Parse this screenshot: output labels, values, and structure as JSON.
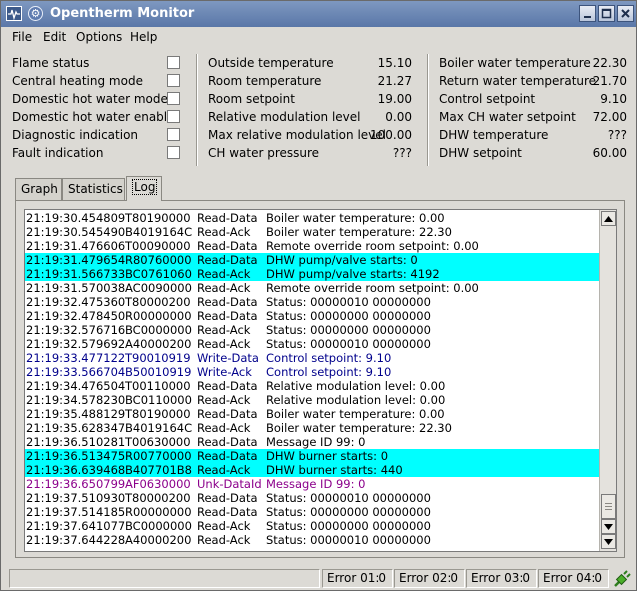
{
  "window": {
    "title": "Opentherm Monitor"
  },
  "menu": [
    "File",
    "Edit",
    "Options",
    "Help"
  ],
  "flags": [
    {
      "label": "Flame status",
      "checked": false
    },
    {
      "label": "Central heating mode",
      "checked": false
    },
    {
      "label": "Domestic hot water mode",
      "checked": false
    },
    {
      "label": "Domestic hot water enable",
      "checked": false
    },
    {
      "label": "Diagnostic indication",
      "checked": false
    },
    {
      "label": "Fault indication",
      "checked": false
    }
  ],
  "middle": [
    {
      "label": "Outside temperature",
      "value": "15.10"
    },
    {
      "label": "Room temperature",
      "value": "21.27"
    },
    {
      "label": "Room setpoint",
      "value": "19.00"
    },
    {
      "label": "Relative modulation level",
      "value": "0.00"
    },
    {
      "label": "Max relative modulation level",
      "value": "100.00"
    },
    {
      "label": "CH water pressure",
      "value": "???"
    }
  ],
  "right": [
    {
      "label": "Boiler water temperature",
      "value": "22.30"
    },
    {
      "label": "Return water temperature",
      "value": "21.70"
    },
    {
      "label": "Control setpoint",
      "value": "9.10"
    },
    {
      "label": "Max CH water setpoint",
      "value": "72.00"
    },
    {
      "label": "DHW temperature",
      "value": "???"
    },
    {
      "label": "DHW setpoint",
      "value": "60.00"
    }
  ],
  "tabs": [
    {
      "label": "Graph",
      "active": false
    },
    {
      "label": "Statistics",
      "active": false
    },
    {
      "label": "Log",
      "active": true
    }
  ],
  "log": [
    {
      "time": "21:19:30.454809",
      "code": "T80190000",
      "type": "Read-Data",
      "msg": "Boiler water temperature: 0.00",
      "style": ""
    },
    {
      "time": "21:19:30.545490",
      "code": "B4019164C",
      "type": "Read-Ack",
      "msg": "Boiler water temperature: 22.30",
      "style": ""
    },
    {
      "time": "21:19:31.476606",
      "code": "T00090000",
      "type": "Read-Data",
      "msg": "Remote override room setpoint: 0.00",
      "style": ""
    },
    {
      "time": "21:19:31.479654",
      "code": "R80760000",
      "type": "Read-Data",
      "msg": "DHW pump/valve starts: 0",
      "style": "hl"
    },
    {
      "time": "21:19:31.566733",
      "code": "BC0761060",
      "type": "Read-Ack",
      "msg": "DHW pump/valve starts: 4192",
      "style": "hl"
    },
    {
      "time": "21:19:31.570038",
      "code": "AC0090000",
      "type": "Read-Ack",
      "msg": "Remote override room setpoint: 0.00",
      "style": ""
    },
    {
      "time": "21:19:32.475360",
      "code": "T80000200",
      "type": "Read-Data",
      "msg": "Status: 00000010 00000000",
      "style": ""
    },
    {
      "time": "21:19:32.478450",
      "code": "R00000000",
      "type": "Read-Data",
      "msg": "Status: 00000000 00000000",
      "style": ""
    },
    {
      "time": "21:19:32.576716",
      "code": "BC0000000",
      "type": "Read-Ack",
      "msg": "Status: 00000000 00000000",
      "style": ""
    },
    {
      "time": "21:19:32.579692",
      "code": "A40000200",
      "type": "Read-Ack",
      "msg": "Status: 00000010 00000000",
      "style": ""
    },
    {
      "time": "21:19:33.477122",
      "code": "T90010919",
      "type": "Write-Data",
      "msg": "Control setpoint: 9.10",
      "style": "blue"
    },
    {
      "time": "21:19:33.566704",
      "code": "B50010919",
      "type": "Write-Ack",
      "msg": "Control setpoint: 9.10",
      "style": "blue"
    },
    {
      "time": "21:19:34.476504",
      "code": "T00110000",
      "type": "Read-Data",
      "msg": "Relative modulation level: 0.00",
      "style": ""
    },
    {
      "time": "21:19:34.578230",
      "code": "BC0110000",
      "type": "Read-Ack",
      "msg": "Relative modulation level: 0.00",
      "style": ""
    },
    {
      "time": "21:19:35.488129",
      "code": "T80190000",
      "type": "Read-Data",
      "msg": "Boiler water temperature: 0.00",
      "style": ""
    },
    {
      "time": "21:19:35.628347",
      "code": "B4019164C",
      "type": "Read-Ack",
      "msg": "Boiler water temperature: 22.30",
      "style": ""
    },
    {
      "time": "21:19:36.510281",
      "code": "T00630000",
      "type": "Read-Data",
      "msg": "Message ID 99: 0",
      "style": ""
    },
    {
      "time": "21:19:36.513475",
      "code": "R00770000",
      "type": "Read-Data",
      "msg": "DHW burner starts: 0",
      "style": "hl"
    },
    {
      "time": "21:19:36.639468",
      "code": "B407701B8",
      "type": "Read-Ack",
      "msg": "DHW burner starts: 440",
      "style": "hl"
    },
    {
      "time": "21:19:36.650799",
      "code": "AF0630000",
      "type": "Unk-DataId",
      "msg": "Message ID 99: 0",
      "style": "purple"
    },
    {
      "time": "21:19:37.510930",
      "code": "T80000200",
      "type": "Read-Data",
      "msg": "Status: 00000010 00000000",
      "style": ""
    },
    {
      "time": "21:19:37.514185",
      "code": "R00000000",
      "type": "Read-Data",
      "msg": "Status: 00000000 00000000",
      "style": ""
    },
    {
      "time": "21:19:37.641077",
      "code": "BC0000000",
      "type": "Read-Ack",
      "msg": "Status: 00000000 00000000",
      "style": ""
    },
    {
      "time": "21:19:37.644228",
      "code": "A40000200",
      "type": "Read-Ack",
      "msg": "Status: 00000010 00000000",
      "style": ""
    }
  ],
  "statusbar": {
    "errors": [
      {
        "label": "Error 01:",
        "value": "0"
      },
      {
        "label": "Error 02:",
        "value": "0"
      },
      {
        "label": "Error 03:",
        "value": "0"
      },
      {
        "label": "Error 04:",
        "value": "0"
      }
    ],
    "connection_icon": "plug-connected-icon"
  }
}
